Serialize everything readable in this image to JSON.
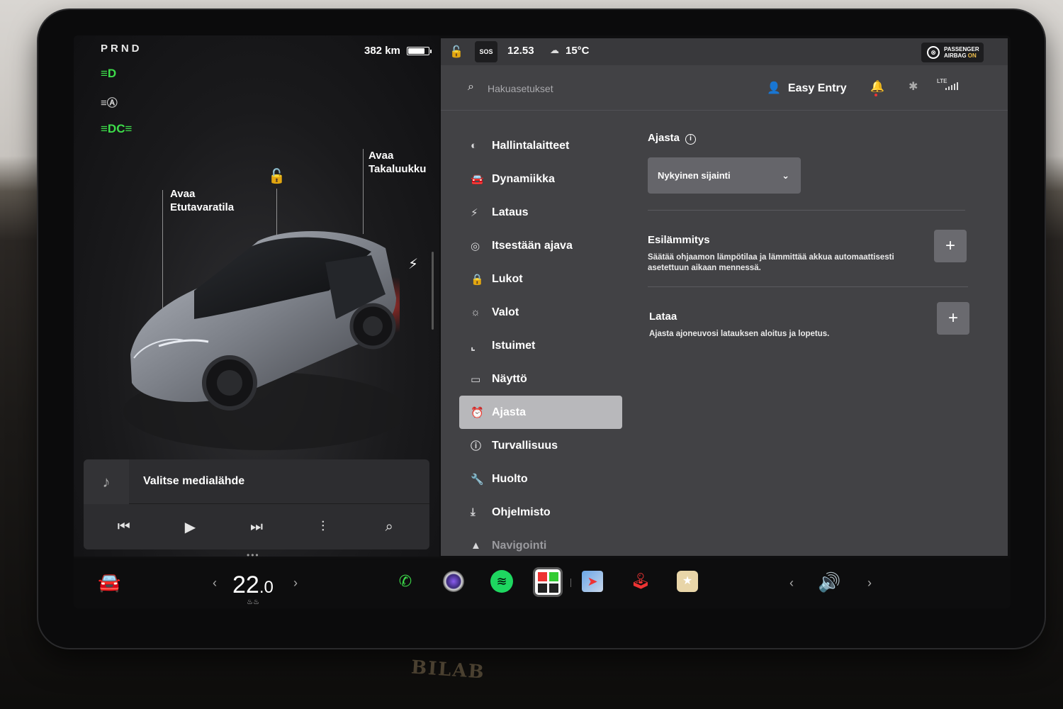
{
  "car": {
    "gears": "PRND",
    "range": "382 km",
    "battery_level": 0.85,
    "callouts": {
      "frunk_line1": "Avaa",
      "frunk_line2": "Etutavaratila",
      "trunk_line1": "Avaa",
      "trunk_line2": "Takaluukku"
    }
  },
  "status": {
    "sos": "SOS",
    "time": "12.53",
    "temperature": "15°C",
    "airbag_line1": "PASSENGER",
    "airbag_line2": "AIRBAG",
    "airbag_state": "ON"
  },
  "search": {
    "placeholder": "Hakuasetukset"
  },
  "profile": {
    "name": "Easy Entry"
  },
  "network": {
    "type": "LTE"
  },
  "menu": {
    "items": [
      {
        "label": "Hallintalaitteet",
        "icon": "toggle-icon"
      },
      {
        "label": "Dynamiikka",
        "icon": "car-icon"
      },
      {
        "label": "Lataus",
        "icon": "bolt-icon"
      },
      {
        "label": "Itsestään ajava",
        "icon": "steering-wheel-icon"
      },
      {
        "label": "Lukot",
        "icon": "lock-icon"
      },
      {
        "label": "Valot",
        "icon": "sun-icon"
      },
      {
        "label": "Istuimet",
        "icon": "seat-icon"
      },
      {
        "label": "Näyttö",
        "icon": "display-icon"
      },
      {
        "label": "Ajasta",
        "icon": "alarm-clock-icon"
      },
      {
        "label": "Turvallisuus",
        "icon": "alert-circle-icon"
      },
      {
        "label": "Huolto",
        "icon": "wrench-icon"
      },
      {
        "label": "Ohjelmisto",
        "icon": "download-icon"
      },
      {
        "label": "Navigointi",
        "icon": "navigation-arrow-icon"
      }
    ],
    "active": "Ajasta"
  },
  "schedule": {
    "title": "Ajasta",
    "location_select": "Nykyinen sijainti",
    "preheat_title": "Esilämmitys",
    "preheat_desc": "Säätää ohjaamon lämpötilaa ja lämmittää akkua automaattisesti asetettuun aikaan mennessä.",
    "charge_title": "Lataa",
    "charge_desc": "Ajasta ajoneuvosi latauksen aloitus ja lopetus."
  },
  "media": {
    "source_label": "Valitse medialähde"
  },
  "climate": {
    "temp_whole": "22",
    "temp_decimal": ".0"
  },
  "dock_apps": [
    "phone-icon",
    "camera-icon",
    "spotify-icon",
    "apps-icon",
    "navigation-icon",
    "joystick-icon",
    "toybox-icon"
  ],
  "dash_badge": "BILAB"
}
